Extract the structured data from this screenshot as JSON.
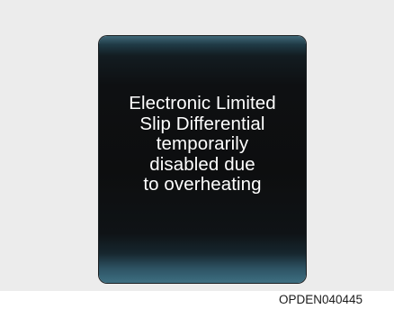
{
  "display": {
    "message_lines": [
      "Electronic Limited",
      "Slip Differential",
      "temporarily",
      "disabled due",
      "to overheating"
    ]
  },
  "figure_code": "OPDEN040445",
  "colors": {
    "panel_background": "#ececec",
    "screen_background": "#0d0e0f",
    "screen_edge_glow": "#3e6f82",
    "message_text": "#ffffff"
  }
}
